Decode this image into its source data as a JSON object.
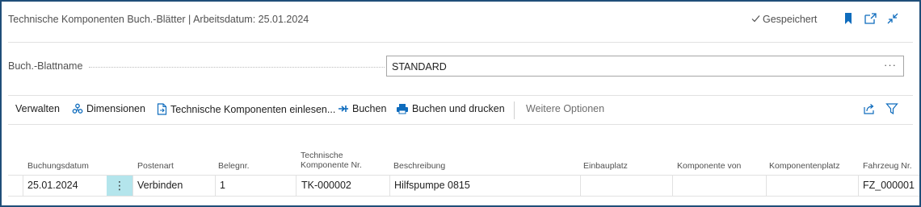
{
  "window": {
    "title": "Technische Komponenten Buch.-Blätter | Arbeitsdatum: 25.01.2024",
    "status": "Gespeichert"
  },
  "icons": {
    "saved": "checkmark-icon",
    "bookmark": "bookmark-icon",
    "open_new": "open-in-new-window-icon",
    "collapse": "collapse-icon",
    "share": "share-icon",
    "filter": "filter-icon",
    "more": "ellipsis-icon"
  },
  "colors": {
    "accent": "#0f6cbd",
    "frame": "#1f4e79",
    "selected_cell": "#b4e5ec"
  },
  "batch": {
    "label": "Buch.-Blattname",
    "value": "STANDARD",
    "more_label": "···"
  },
  "toolbar": {
    "manage": "Verwalten",
    "dimensions": "Dimensionen",
    "import": "Technische Komponenten einlesen...",
    "post": "Buchen",
    "post_print": "Buchen und drucken",
    "more_options": "Weitere Optionen"
  },
  "table": {
    "columns": {
      "posting_date": "Buchungsdatum",
      "entry_type": "Postenart",
      "doc_no": "Belegnr.",
      "component_no_1": "Technische",
      "component_no_2": "Komponente Nr.",
      "description": "Beschreibung",
      "install_location": "Einbauplatz",
      "component_of": "Komponente von",
      "component_location": "Komponentenplatz",
      "vehicle_no": "Fahrzeug Nr."
    },
    "rows": [
      {
        "posting_date": "25.01.2024",
        "row_menu": "⋮",
        "entry_type": "Verbinden",
        "doc_no": "1",
        "component_no": "TK-000002",
        "description": "Hilfspumpe 0815",
        "install_location": "",
        "component_of": "",
        "component_location": "",
        "vehicle_no": "FZ_000001"
      }
    ]
  }
}
